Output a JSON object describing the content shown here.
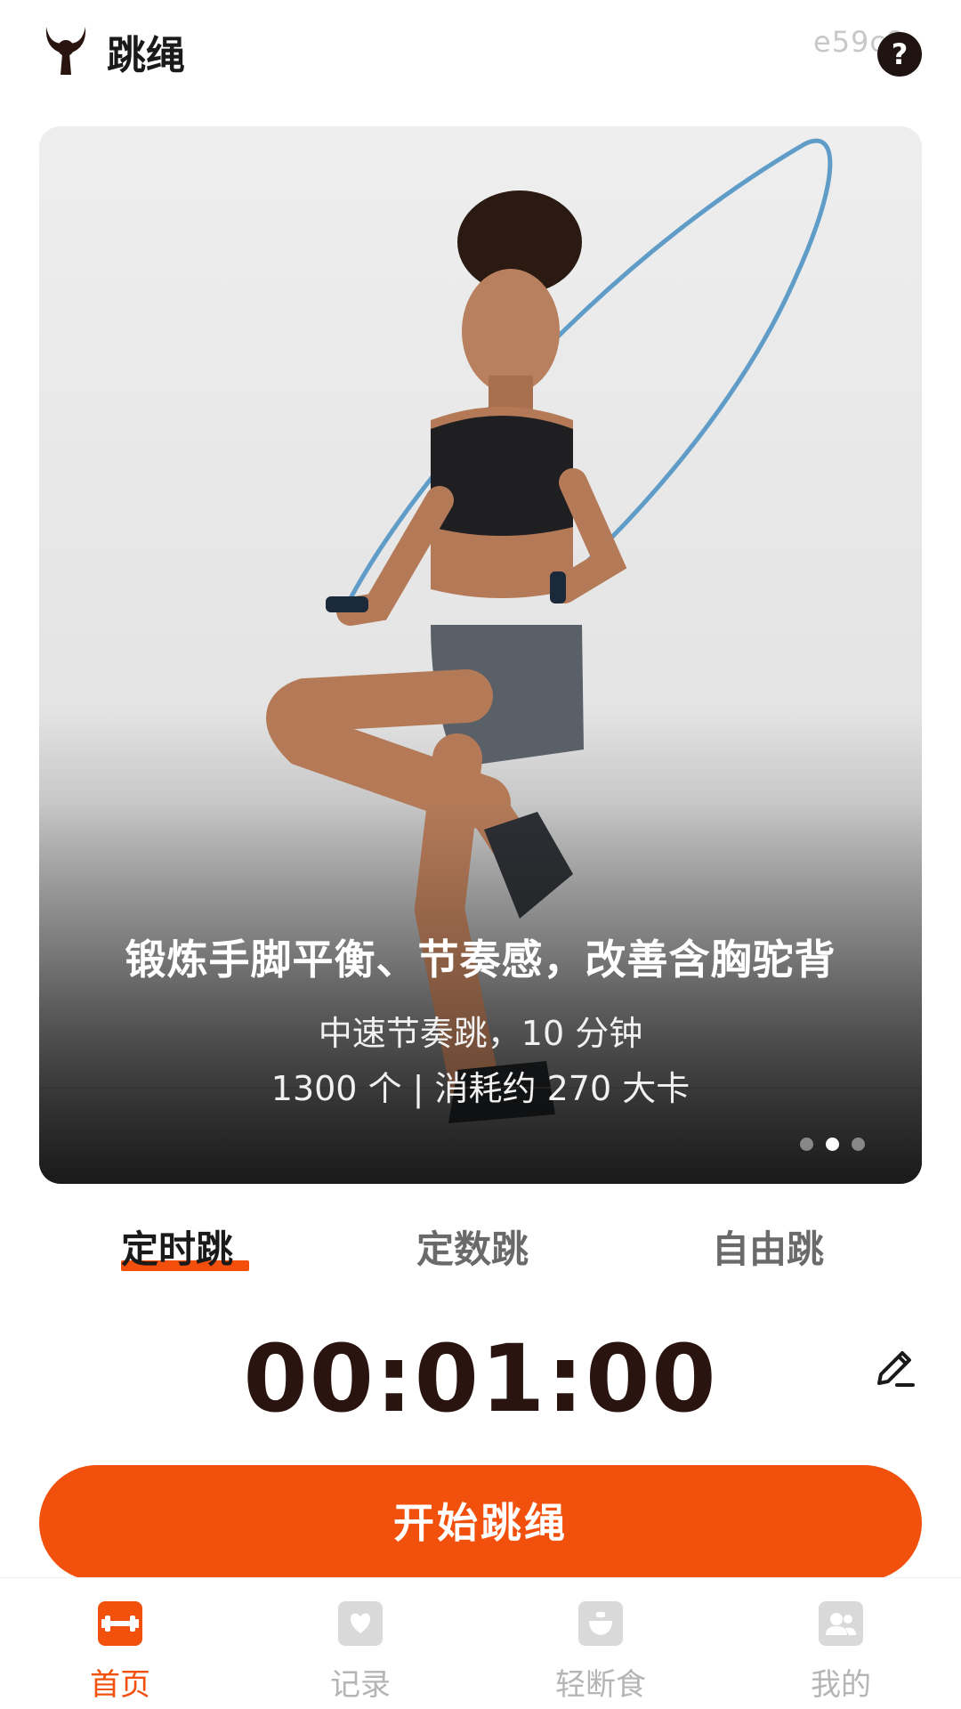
{
  "header": {
    "app_title": "跳绳",
    "user_code": "e59c8",
    "help_label": "?"
  },
  "banner": {
    "title": "锻炼手脚平衡、节奏感，改善含胸驼背",
    "subtitle_line1": "中速节奏跳，10 分钟",
    "subtitle_line2": "1300 个 | 消耗约 270 大卡",
    "active_slide": 2,
    "slide_count": 3
  },
  "mode_tabs": [
    {
      "label": "定时跳",
      "active": true
    },
    {
      "label": "定数跳",
      "active": false
    },
    {
      "label": "自由跳",
      "active": false
    }
  ],
  "timer": {
    "value": "00:01:00"
  },
  "start_button": {
    "label": "开始跳绳"
  },
  "bottom_nav": [
    {
      "label": "首页",
      "icon": "dumbbell-icon",
      "active": true
    },
    {
      "label": "记录",
      "icon": "record-icon",
      "active": false
    },
    {
      "label": "轻断食",
      "icon": "food-icon",
      "active": false
    },
    {
      "label": "我的",
      "icon": "profile-icon",
      "active": false
    }
  ],
  "colors": {
    "accent": "#f2500d",
    "timer_text": "#2a1410",
    "inactive": "#b5b5b5"
  }
}
